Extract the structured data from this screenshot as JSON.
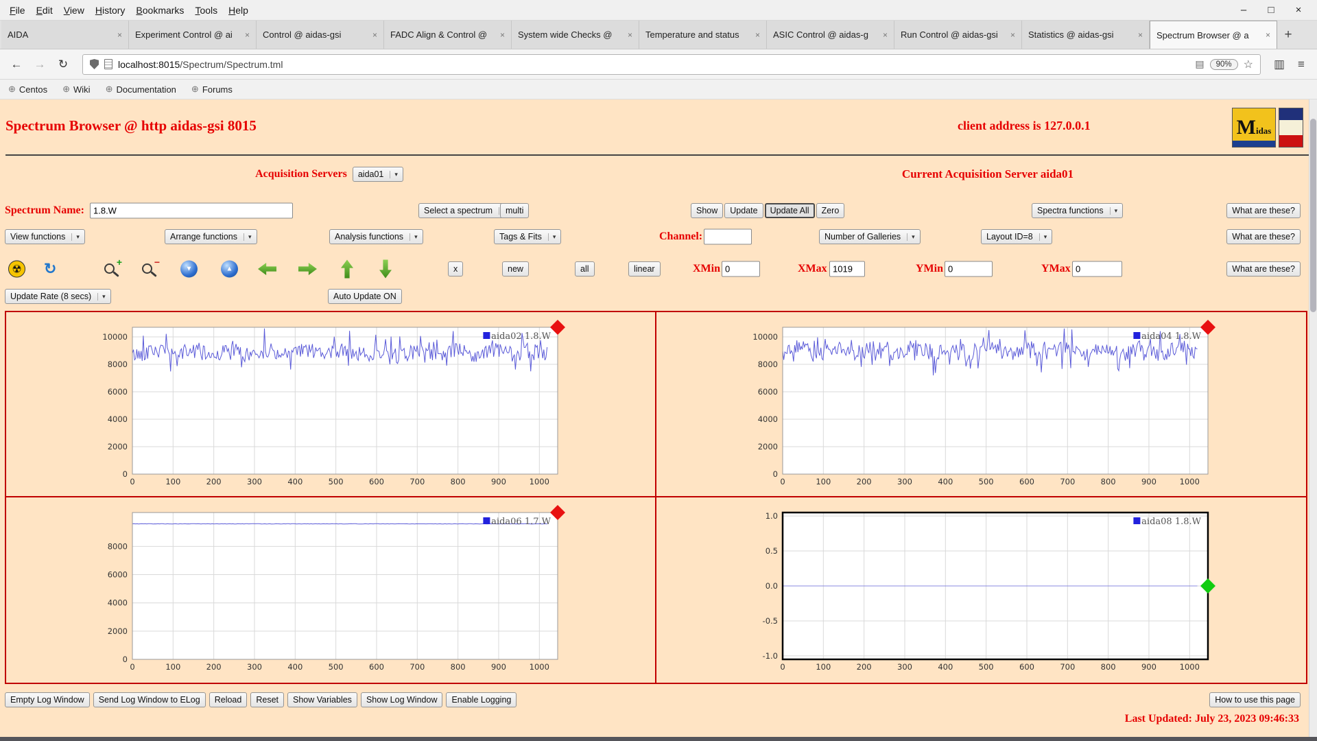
{
  "window": {
    "menu": [
      "File",
      "Edit",
      "View",
      "History",
      "Bookmarks",
      "Tools",
      "Help"
    ],
    "new_tab_button": "+",
    "controls": {
      "minimize": "–",
      "maximize": "□",
      "close": "×"
    }
  },
  "tabs": [
    {
      "label": "AIDA"
    },
    {
      "label": "Experiment Control @ ai"
    },
    {
      "label": "Control @ aidas-gsi"
    },
    {
      "label": "FADC Align & Control @"
    },
    {
      "label": "System wide Checks @"
    },
    {
      "label": "Temperature and status"
    },
    {
      "label": "ASIC Control @ aidas-g"
    },
    {
      "label": "Run Control @ aidas-gsi"
    },
    {
      "label": "Statistics @ aidas-gsi"
    },
    {
      "label": "Spectrum Browser @ a",
      "active": true
    }
  ],
  "navbar": {
    "url_host": "localhost:8015",
    "url_path": "/Spectrum/Spectrum.tml",
    "zoom": "90%"
  },
  "bookmarks": [
    "Centos",
    "Wiki",
    "Documentation",
    "Forums"
  ],
  "icons": {
    "back": "←",
    "forward": "→",
    "reload": "↻",
    "reader": "▤",
    "star": "☆",
    "library": "▥",
    "hamburger": "≡",
    "globe": "⊕",
    "tab_close": "×",
    "caret": "▾",
    "radiation": "☢",
    "refresh": "↻",
    "sphere_down": "▼",
    "sphere_up": "▲",
    "mag_plus": "+",
    "mag_minus": "−"
  },
  "page": {
    "title": "Spectrum Browser @ http aidas-gsi 8015",
    "client_address": "client address is 127.0.0.1",
    "logo_text": "Midas",
    "acquisition_servers_label": "Acquisition Servers",
    "acquisition_server_selected": "aida01",
    "current_server_text": "Current Acquisition Server aida01",
    "spectrum_name_label": "Spectrum Name:",
    "spectrum_name_value": "1.8.W",
    "select_spectrum_label": "Select a spectrum",
    "multi_button": "multi",
    "show_button": "Show",
    "update_button": "Update",
    "update_all_button": "Update All",
    "zero_button": "Zero",
    "spectra_functions_label": "Spectra functions",
    "what_are_these_button": "What are these?",
    "view_functions_label": "View functions",
    "arrange_functions_label": "Arrange functions",
    "analysis_functions_label": "Analysis functions",
    "tags_fits_label": "Tags & Fits",
    "channel_label": "Channel:",
    "channel_value": "",
    "number_of_galleries_label": "Number of Galleries",
    "layout_id_label": "Layout ID=8",
    "x_button": "x",
    "new_button": "new",
    "all_button": "all",
    "linear_button": "linear",
    "xmin_label": "XMin",
    "xmin_value": "0",
    "xmax_label": "XMax",
    "xmax_value": "1019",
    "ymin_label": "YMin",
    "ymin_value": "0",
    "ymax_label": "YMax",
    "ymax_value": "0",
    "update_rate_label": "Update Rate (8 secs)",
    "auto_update_button": "Auto Update ON",
    "footer_buttons": [
      "Empty Log Window",
      "Send Log Window to ELog",
      "Reload",
      "Reset",
      "Show Variables",
      "Show Log Window",
      "Enable Logging"
    ],
    "how_to_button": "How to use this page",
    "last_updated": "Last Updated: July 23, 2023 09:46:33"
  },
  "chart_data": [
    {
      "type": "line",
      "id": "aida02",
      "legend": "aida02 1.8.W",
      "line_color": "#5a5ad8",
      "swatch": "#2222dd",
      "frame": "thin",
      "grid": true,
      "xlim": [
        0,
        1045
      ],
      "x_ticks": [
        0,
        100,
        200,
        300,
        400,
        500,
        600,
        700,
        800,
        900,
        1000
      ],
      "x_tick_labels": [
        "0",
        "100",
        "200",
        "300",
        "400",
        "500",
        "600",
        "700",
        "800",
        "900",
        "1000"
      ],
      "ylim": [
        0,
        10700
      ],
      "y_ticks": [
        0,
        2000,
        4000,
        6000,
        8000,
        10000
      ],
      "y_tick_labels": [
        "0",
        "2000",
        "4000",
        "6000",
        "8000",
        "10000"
      ],
      "gen": {
        "kind": "noisy",
        "baseline": 8850,
        "jitter": 550,
        "wobble": 170,
        "spike": 1250,
        "spike_prob": 0.08,
        "dip": 1150,
        "dip_prob": 0.08,
        "seed": 42,
        "points": 380,
        "xmax": 1019
      },
      "marker": {
        "shape": "diamond",
        "color": "#e81111",
        "position": "top-right"
      }
    },
    {
      "type": "line",
      "id": "aida04",
      "legend": "aida04 1.8.W",
      "line_color": "#5a5ad8",
      "swatch": "#2222dd",
      "frame": "thin",
      "grid": true,
      "xlim": [
        0,
        1045
      ],
      "x_ticks": [
        0,
        100,
        200,
        300,
        400,
        500,
        600,
        700,
        800,
        900,
        1000
      ],
      "x_tick_labels": [
        "0",
        "100",
        "200",
        "300",
        "400",
        "500",
        "600",
        "700",
        "800",
        "900",
        "1000"
      ],
      "ylim": [
        0,
        10700
      ],
      "y_ticks": [
        0,
        2000,
        4000,
        6000,
        8000,
        10000
      ],
      "y_tick_labels": [
        "0",
        "2000",
        "4000",
        "6000",
        "8000",
        "10000"
      ],
      "gen": {
        "kind": "noisy",
        "baseline": 9000,
        "jitter": 520,
        "wobble": 260,
        "spike": 1250,
        "spike_prob": 0.07,
        "dip": 1250,
        "dip_prob": 0.09,
        "seed": 137,
        "points": 380,
        "xmax": 1019
      },
      "marker": {
        "shape": "diamond",
        "color": "#e81111",
        "position": "top-right"
      }
    },
    {
      "type": "line",
      "id": "aida06",
      "legend": "aida06 1.7.W",
      "line_color": "#5a5ad8",
      "swatch": "#2222dd",
      "frame": "thin",
      "grid": true,
      "xlim": [
        0,
        1045
      ],
      "x_ticks": [
        0,
        100,
        200,
        300,
        400,
        500,
        600,
        700,
        800,
        900,
        1000
      ],
      "x_tick_labels": [
        "0",
        "100",
        "200",
        "300",
        "400",
        "500",
        "600",
        "700",
        "800",
        "900",
        "1000"
      ],
      "ylim": [
        0,
        10400
      ],
      "y_ticks": [
        0,
        2000,
        4000,
        6000,
        8000
      ],
      "y_tick_labels": [
        "0",
        "2000",
        "4000",
        "6000",
        "8000"
      ],
      "gen": {
        "kind": "flat",
        "value": 9600,
        "jitter": 14,
        "seed": 5,
        "points": 260,
        "xmax": 1019
      },
      "marker": {
        "shape": "diamond",
        "color": "#e81111",
        "position": "top-right"
      }
    },
    {
      "type": "line",
      "id": "aida08",
      "legend": "aida08 1.8.W",
      "line_color": "#8888e0",
      "swatch": "#2222dd",
      "frame": "thick",
      "grid": true,
      "xlim": [
        0,
        1045
      ],
      "x_ticks": [
        0,
        100,
        200,
        300,
        400,
        500,
        600,
        700,
        800,
        900,
        1000
      ],
      "x_tick_labels": [
        "0",
        "100",
        "200",
        "300",
        "400",
        "500",
        "600",
        "700",
        "800",
        "900",
        "1000"
      ],
      "ylim": [
        -1.05,
        1.05
      ],
      "y_ticks": [
        -1,
        -0.5,
        0,
        0.5,
        1
      ],
      "y_tick_labels": [
        "-1.0",
        "-0.5",
        "0.0",
        "0.5",
        "1.0"
      ],
      "gen": {
        "kind": "flat",
        "value": 0,
        "jitter": 0,
        "seed": 1,
        "points": 60,
        "xmax": 1019
      },
      "marker": {
        "shape": "diamond",
        "color": "#11cc11",
        "position": "mid-right",
        "y": 0
      }
    }
  ]
}
